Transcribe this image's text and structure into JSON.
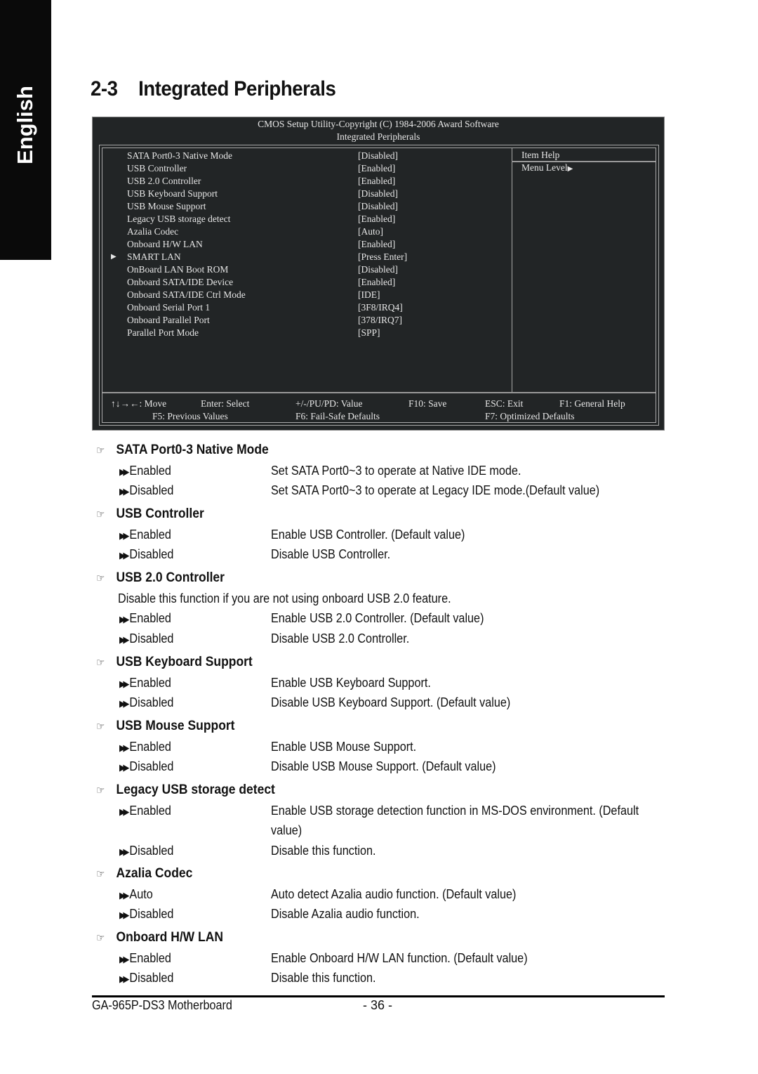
{
  "side_tab": {
    "label": "English"
  },
  "heading": {
    "number": "2-3",
    "title": "Integrated Peripherals"
  },
  "bios": {
    "title_line1": "CMOS Setup Utility-Copyright (C) 1984-2006 Award Software",
    "title_line2": "Integrated Peripherals",
    "items": [
      {
        "label": "SATA Port0-3 Native Mode",
        "value": "[Disabled]",
        "submenu": false
      },
      {
        "label": "USB Controller",
        "value": "[Enabled]",
        "submenu": false
      },
      {
        "label": "USB 2.0 Controller",
        "value": "[Enabled]",
        "submenu": false
      },
      {
        "label": "USB Keyboard Support",
        "value": "[Disabled]",
        "submenu": false
      },
      {
        "label": "USB Mouse Support",
        "value": "[Disabled]",
        "submenu": false
      },
      {
        "label": "Legacy USB storage detect",
        "value": "[Enabled]",
        "submenu": false
      },
      {
        "label": "Azalia Codec",
        "value": "[Auto]",
        "submenu": false
      },
      {
        "label": "Onboard H/W LAN",
        "value": "[Enabled]",
        "submenu": false
      },
      {
        "label": "SMART LAN",
        "value": "[Press Enter]",
        "submenu": true
      },
      {
        "label": "OnBoard LAN Boot ROM",
        "value": "[Disabled]",
        "submenu": false
      },
      {
        "label": "Onboard SATA/IDE Device",
        "value": "[Enabled]",
        "submenu": false
      },
      {
        "label": "Onboard SATA/IDE Ctrl Mode",
        "value": "[IDE]",
        "submenu": false
      },
      {
        "label": "Onboard Serial Port 1",
        "value": "[3F8/IRQ4]",
        "submenu": false
      },
      {
        "label": "Onboard Parallel Port",
        "value": "[378/IRQ7]",
        "submenu": false
      },
      {
        "label": "Parallel Port Mode",
        "value": "[SPP]",
        "submenu": false
      }
    ],
    "help": {
      "title": "Item Help",
      "menu_level": "Menu Level"
    },
    "keys": {
      "move": "↑↓→←: Move",
      "select": "Enter: Select",
      "value": "+/-/PU/PD: Value",
      "save": "F10: Save",
      "exit": "ESC: Exit",
      "general_help": "F1: General Help",
      "previous": "F5: Previous Values",
      "failsafe": "F6: Fail-Safe Defaults",
      "optimized": "F7: Optimized Defaults"
    }
  },
  "sections": [
    {
      "title": "SATA Port0-3 Native Mode",
      "note": null,
      "options": [
        {
          "name": "Enabled",
          "desc": "Set SATA Port0~3 to operate at Native IDE mode."
        },
        {
          "name": "Disabled",
          "desc": "Set SATA Port0~3 to operate at Legacy IDE mode.(Default value)"
        }
      ]
    },
    {
      "title": "USB Controller",
      "note": null,
      "options": [
        {
          "name": "Enabled",
          "desc": "Enable USB Controller. (Default value)"
        },
        {
          "name": "Disabled",
          "desc": "Disable USB Controller."
        }
      ]
    },
    {
      "title": "USB 2.0 Controller",
      "note": "Disable this function if you are not using onboard USB 2.0 feature.",
      "options": [
        {
          "name": "Enabled",
          "desc": "Enable USB 2.0 Controller. (Default value)"
        },
        {
          "name": "Disabled",
          "desc": "Disable USB 2.0 Controller."
        }
      ]
    },
    {
      "title": "USB Keyboard Support",
      "note": null,
      "options": [
        {
          "name": "Enabled",
          "desc": "Enable USB Keyboard Support."
        },
        {
          "name": "Disabled",
          "desc": "Disable USB Keyboard Support. (Default value)"
        }
      ]
    },
    {
      "title": "USB Mouse Support",
      "note": null,
      "options": [
        {
          "name": "Enabled",
          "desc": "Enable USB Mouse Support."
        },
        {
          "name": "Disabled",
          "desc": "Disable USB Mouse Support. (Default value)"
        }
      ]
    },
    {
      "title": "Legacy USB storage detect",
      "note": null,
      "options": [
        {
          "name": "Enabled",
          "desc": "Enable USB storage detection function in MS-DOS environment. (Default",
          "desc_cont": "value)"
        },
        {
          "name": "Disabled",
          "desc": "Disable this function."
        }
      ]
    },
    {
      "title": "Azalia Codec",
      "note": null,
      "options": [
        {
          "name": "Auto",
          "desc": "Auto detect Azalia audio function. (Default value)"
        },
        {
          "name": "Disabled",
          "desc": "Disable Azalia audio function."
        }
      ]
    },
    {
      "title": "Onboard H/W LAN",
      "note": null,
      "options": [
        {
          "name": "Enabled",
          "desc": "Enable Onboard H/W LAN function. (Default value)"
        },
        {
          "name": "Disabled",
          "desc": "Disable this function."
        }
      ]
    }
  ],
  "footer": {
    "product": "GA-965P-DS3 Motherboard",
    "page": "- 36 -"
  }
}
